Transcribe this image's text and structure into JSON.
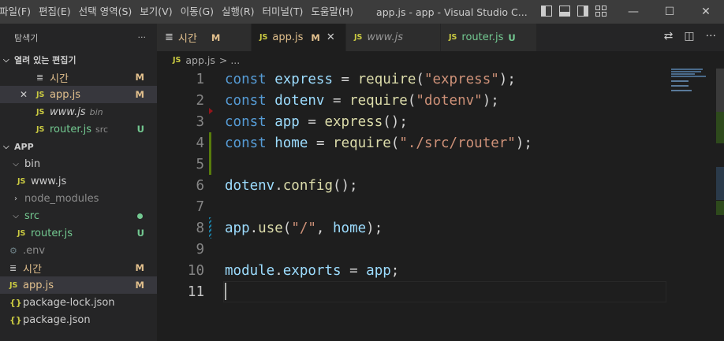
{
  "menu": [
    "파일(F)",
    "편집(E)",
    "선택 영역(S)",
    "보기(V)",
    "이동(G)",
    "실행(R)",
    "터미널(T)",
    "도움말(H)"
  ],
  "window_title": "app.js - app - Visual Studio C...",
  "window_buttons": {
    "minimize": "—",
    "maximize": "☐",
    "close": "✕"
  },
  "explorer": {
    "title": "탐색기",
    "more": "···",
    "open_editors_label": "열려 있는 편집기",
    "open_editors": [
      {
        "name": "시간",
        "badge": "M",
        "icon": "list-icon"
      },
      {
        "name": "app.js",
        "badge": "M",
        "icon": "js-icon",
        "close": "✕",
        "selected": true
      },
      {
        "name": "www.js",
        "desc": "bin",
        "icon": "js-icon"
      },
      {
        "name": "router.js",
        "desc": "src",
        "badge": "U",
        "icon": "js-icon"
      }
    ],
    "project_label": "APP",
    "tree": {
      "bin": "bin",
      "www": "www.js",
      "node_modules": "node_modules",
      "src": "src",
      "router": "router.js",
      "router_badge": "U",
      "env": ".env",
      "sigan": "시간",
      "sigan_badge": "M",
      "app": "app.js",
      "app_badge": "M",
      "package_lock": "package-lock.json",
      "package": "package.json"
    }
  },
  "tabs": [
    {
      "label": "시간",
      "mark": "M",
      "icon": "list-icon"
    },
    {
      "label": "app.js",
      "mark": "M",
      "icon": "js-icon",
      "active": true
    },
    {
      "label": "www.js",
      "icon": "js-icon"
    },
    {
      "label": "router.js",
      "mark": "U",
      "icon": "js-icon"
    }
  ],
  "js_label": "JS",
  "breadcrumb": {
    "file": "app.js",
    "rest": "> ..."
  },
  "code_lines": [
    {
      "n": "1"
    },
    {
      "n": "2"
    },
    {
      "n": "3"
    },
    {
      "n": "4"
    },
    {
      "n": "5"
    },
    {
      "n": "6"
    },
    {
      "n": "7"
    },
    {
      "n": "8"
    },
    {
      "n": "9"
    },
    {
      "n": "10"
    },
    {
      "n": "11"
    }
  ],
  "code": {
    "l1": [
      "const",
      "express",
      "=",
      "require",
      "(",
      "\"express\"",
      ");"
    ],
    "l2": [
      "const",
      "dotenv",
      "=",
      "require",
      "(",
      "\"dotenv\"",
      ");"
    ],
    "l3": [
      "const",
      "app",
      "=",
      "express",
      "();"
    ],
    "l4": [
      "const",
      "home",
      "=",
      "require",
      "(",
      "\"./src/router\"",
      ");"
    ],
    "l6": [
      "dotenv",
      ".",
      "config",
      "();"
    ],
    "l8": [
      "app",
      ".",
      "use",
      "(",
      "\"/\"",
      ", ",
      "home",
      ");"
    ],
    "l10": [
      "module",
      ".",
      "exports",
      "=",
      "app",
      ";"
    ]
  },
  "colors": {
    "keyword": "#569cd6",
    "variable": "#9cdcfe",
    "function": "#dcdcaa",
    "string": "#ce9178",
    "modified": "#e2c08d",
    "untracked": "#73c991"
  }
}
